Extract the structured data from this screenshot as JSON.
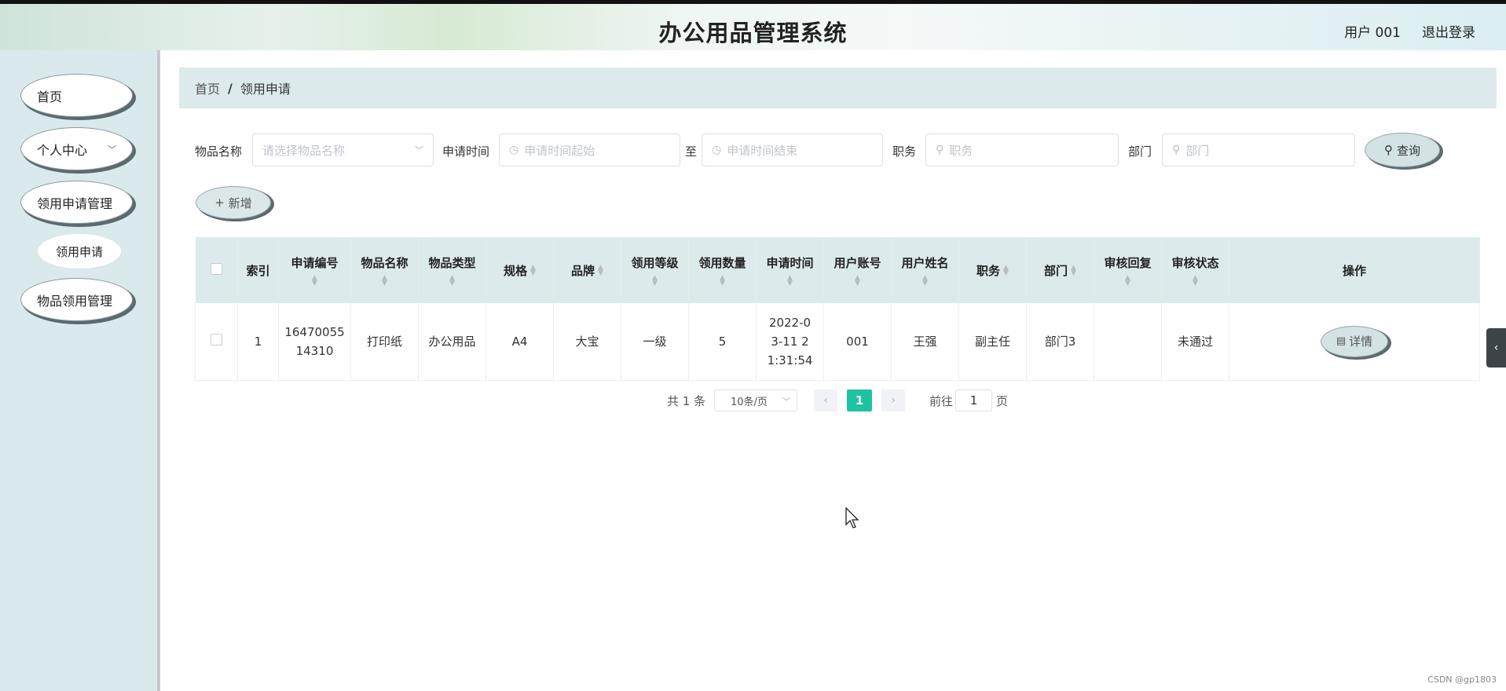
{
  "header": {
    "title": "办公用品管理系统",
    "user": "用户 001",
    "logout": "退出登录"
  },
  "sidebar": {
    "items": [
      {
        "label": "首页"
      },
      {
        "label": "个人中心"
      },
      {
        "label": "领用申请管理"
      },
      {
        "label": "领用申请"
      },
      {
        "label": "物品领用管理"
      }
    ]
  },
  "breadcrumb": {
    "home": "首页",
    "sep": "/",
    "current": "领用申请"
  },
  "filters": {
    "item_name_label": "物品名称",
    "item_name_placeholder": "请选择物品名称",
    "time_label": "申请时间",
    "time_start_placeholder": "申请时间起始",
    "to": "至",
    "time_end_placeholder": "申请时间结束",
    "position_label": "职务",
    "position_placeholder": "职务",
    "dept_label": "部门",
    "dept_placeholder": "部门",
    "query_button": "查询"
  },
  "add_button": "新增",
  "table": {
    "headers": [
      "索引",
      "申请编号",
      "物品名称",
      "物品类型",
      "规格",
      "品牌",
      "领用等级",
      "领用数量",
      "申请时间",
      "用户账号",
      "用户姓名",
      "职务",
      "部门",
      "审核回复",
      "审核状态",
      "操作"
    ],
    "rows": [
      {
        "index": "1",
        "apply_no": "1647005514310",
        "item_name": "打印纸",
        "item_type": "办公用品",
        "spec": "A4",
        "brand": "大宝",
        "level": "一级",
        "qty": "5",
        "apply_time": "2022-03-11 21:31:54",
        "account": "001",
        "username": "王强",
        "position": "副主任",
        "dept": "部门3",
        "review_reply": "",
        "review_status": "未通过",
        "action": "详情"
      }
    ]
  },
  "pagination": {
    "total": "共 1 条",
    "page_size": "10条/页",
    "current_page": "1",
    "goto": "前往",
    "goto_value": "1",
    "page_unit": "页"
  },
  "watermark": "CSDN @gp1803",
  "colors": {
    "accent": "#1fc3a3",
    "panel": "#dceaec",
    "sidebar": "#d9e9ec"
  }
}
